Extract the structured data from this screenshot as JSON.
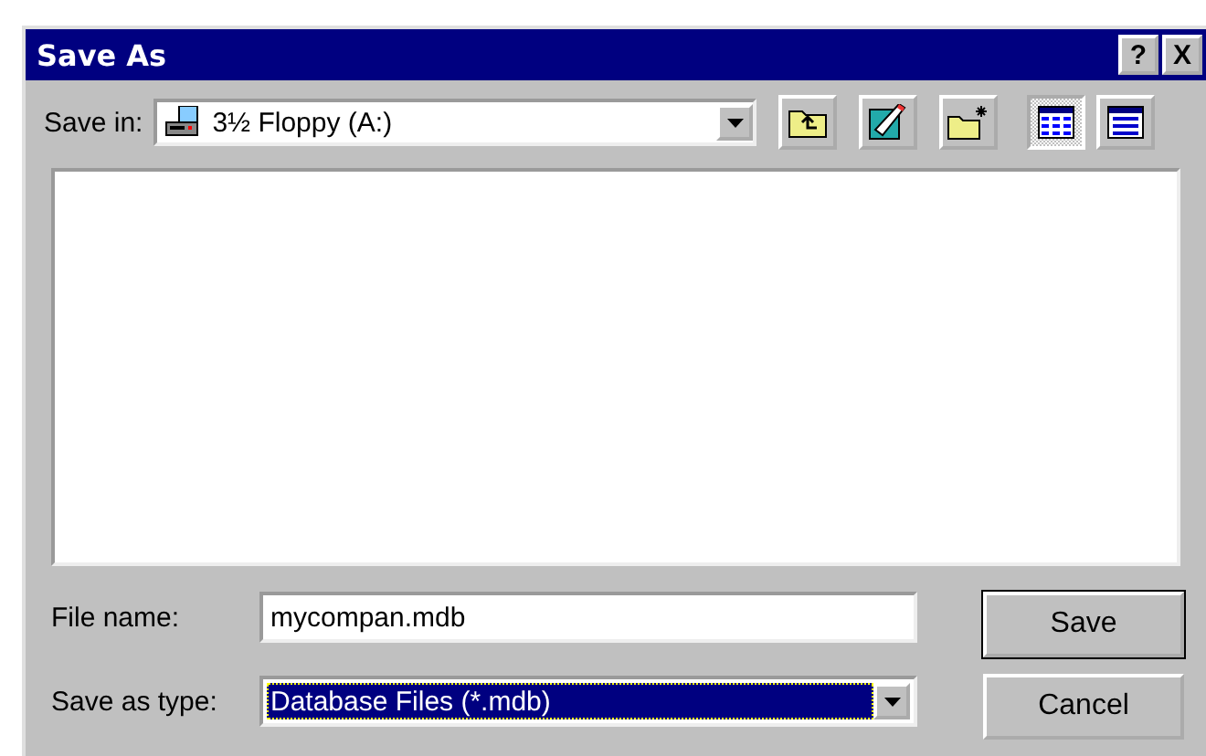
{
  "window": {
    "title": "Save As",
    "help": "?",
    "close": "X"
  },
  "save_in": {
    "label": "Save in:",
    "value": "3½ Floppy (A:)"
  },
  "view_buttons": [
    {
      "kind": "list",
      "selected": true
    },
    {
      "kind": "details",
      "selected": false
    }
  ],
  "file_name": {
    "label": "File name:",
    "value": "mycompan.mdb"
  },
  "save_as_type": {
    "label": "Save as type:",
    "value": "Database Files (*.mdb)",
    "highlighted": true
  },
  "buttons": [
    {
      "label": "Save",
      "default": true
    },
    {
      "label": "Cancel",
      "default": false
    }
  ]
}
